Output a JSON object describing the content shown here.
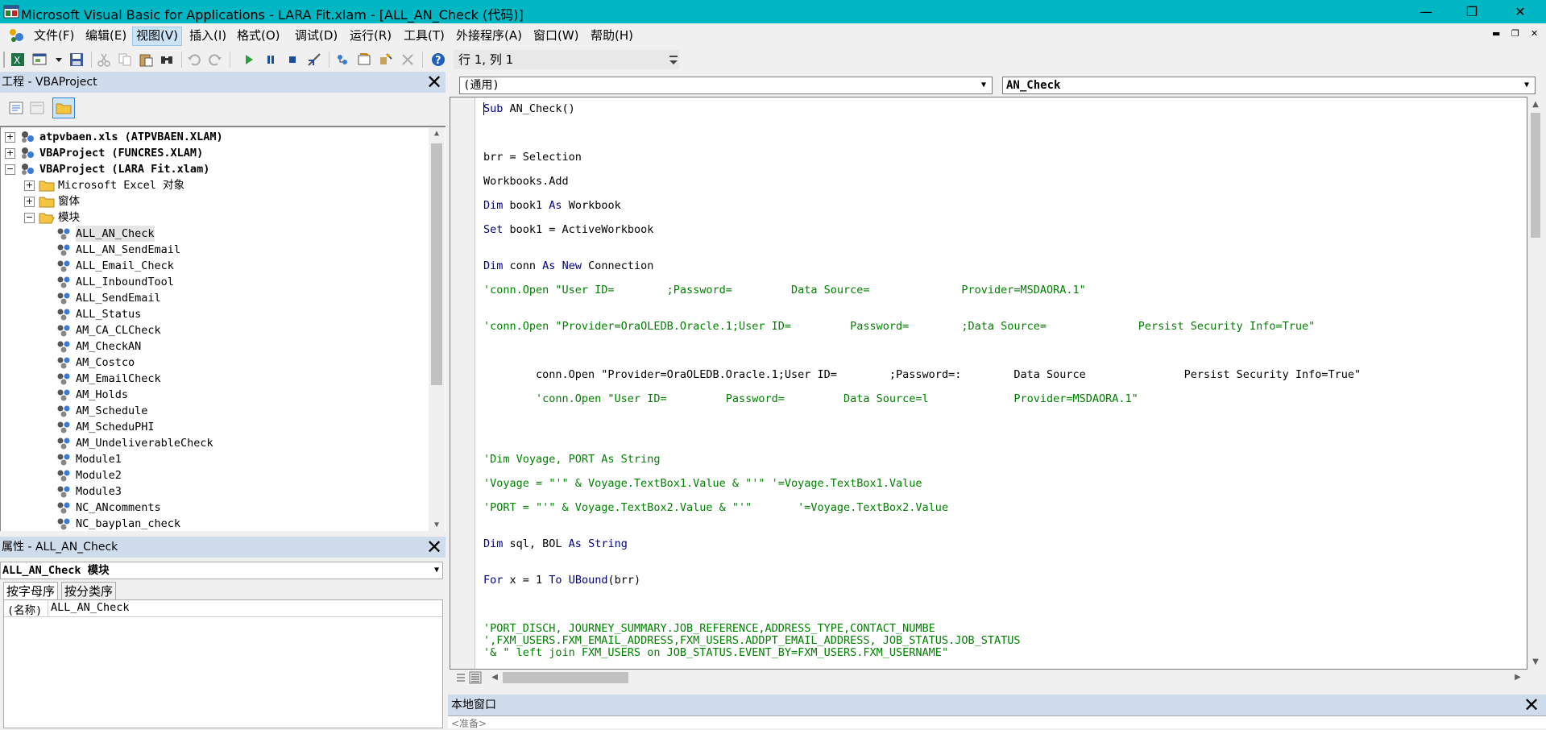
{
  "window": {
    "title": "Microsoft Visual Basic for Applications - LARA Fit.xlam - [ALL_AN_Check (代码)]",
    "minimize": "—",
    "restore": "❐",
    "close": "✕"
  },
  "menu": {
    "items": [
      {
        "label": "文件(F)"
      },
      {
        "label": "编辑(E)"
      },
      {
        "label": "视图(V)"
      },
      {
        "label": "插入(I)"
      },
      {
        "label": "格式(O)"
      },
      {
        "label": "调试(D)"
      },
      {
        "label": "运行(R)"
      },
      {
        "label": "工具(T)"
      },
      {
        "label": "外接程序(A)"
      },
      {
        "label": "窗口(W)"
      },
      {
        "label": "帮助(H)"
      }
    ],
    "active_index": 2,
    "mdi_minimize": "▬",
    "mdi_restore": "❐",
    "mdi_close": "✕"
  },
  "toolbar": {
    "position_label": "行 1, 列 1"
  },
  "project": {
    "header": "工程 - VBAProject",
    "close": "✕",
    "tree": [
      {
        "label": "atpvbaen.xls (ATPVBAEN.XLAM)",
        "expander": "+",
        "icon": "vba-project-icon",
        "bold": true
      },
      {
        "label": "VBAProject (FUNCRES.XLAM)",
        "expander": "+",
        "icon": "vba-project-icon",
        "bold": true
      },
      {
        "label": "VBAProject (LARA Fit.xlam)",
        "expander": "−",
        "icon": "vba-project-icon",
        "bold": true
      },
      {
        "label": "Microsoft Excel 对象",
        "expander": "+",
        "icon": "folder-icon"
      },
      {
        "label": "窗体",
        "expander": "+",
        "icon": "folder-icon"
      },
      {
        "label": "模块",
        "expander": "−",
        "icon": "folder-open-icon"
      },
      {
        "label": "ALL_AN_Check",
        "icon": "module-icon",
        "selected": true
      },
      {
        "label": "ALL_AN_SendEmail",
        "icon": "module-icon"
      },
      {
        "label": "ALL_Email_Check",
        "icon": "module-icon"
      },
      {
        "label": "ALL_InboundTool",
        "icon": "module-icon"
      },
      {
        "label": "ALL_SendEmail",
        "icon": "module-icon"
      },
      {
        "label": "ALL_Status",
        "icon": "module-icon"
      },
      {
        "label": "AM_CA_CLCheck",
        "icon": "module-icon"
      },
      {
        "label": "AM_CheckAN",
        "icon": "module-icon"
      },
      {
        "label": "AM_Costco",
        "icon": "module-icon"
      },
      {
        "label": "AM_EmailCheck",
        "icon": "module-icon"
      },
      {
        "label": "AM_Holds",
        "icon": "module-icon"
      },
      {
        "label": "AM_Schedule",
        "icon": "module-icon"
      },
      {
        "label": "AM_ScheduPHI",
        "icon": "module-icon"
      },
      {
        "label": "AM_UndeliverableCheck",
        "icon": "module-icon"
      },
      {
        "label": "Module1",
        "icon": "module-icon"
      },
      {
        "label": "Module2",
        "icon": "module-icon"
      },
      {
        "label": "Module3",
        "icon": "module-icon"
      },
      {
        "label": "NC_ANcomments",
        "icon": "module-icon"
      },
      {
        "label": "NC_bayplan_check",
        "icon": "module-icon"
      }
    ]
  },
  "properties": {
    "header": "属性 - ALL_AN_Check",
    "close": "✕",
    "object_combo": "ALL_AN_Check 模块",
    "tabs": [
      "按字母序",
      "按分类序"
    ],
    "active_tab": 0,
    "rows": [
      {
        "name": "(名称)",
        "value": "ALL_AN_Check"
      }
    ]
  },
  "code": {
    "object_combo": "(通用)",
    "procedure_combo": "AN_Check",
    "lines": [
      [
        {
          "t": "Sub",
          "c": "kw"
        },
        {
          "t": " AN_Check()",
          "c": ""
        }
      ],
      [
        {
          "t": "brr = Selection",
          "c": ""
        }
      ],
      [
        {
          "t": "Workbooks.Add",
          "c": ""
        }
      ],
      [
        {
          "t": "Dim",
          "c": "kw"
        },
        {
          "t": " book1 ",
          "c": ""
        },
        {
          "t": "As",
          "c": "kw"
        },
        {
          "t": " Workbook",
          "c": ""
        }
      ],
      [
        {
          "t": "Set",
          "c": "kw"
        },
        {
          "t": " book1 = ActiveWorkbook",
          "c": ""
        }
      ],
      [
        {
          "t": "Dim",
          "c": "kw"
        },
        {
          "t": " conn ",
          "c": ""
        },
        {
          "t": "As",
          "c": "kw"
        },
        {
          "t": " ",
          "c": ""
        },
        {
          "t": "New",
          "c": "kw"
        },
        {
          "t": " Connection",
          "c": ""
        }
      ],
      [
        {
          "t": "'conn.Open \"User ID=        ;Password=         Data Source=              Provider=MSDAORA.1\"",
          "c": "cm"
        }
      ],
      [
        {
          "t": "'conn.Open \"Provider=OraOLEDB.Oracle.1;User ID=         Password=        ;Data Source=              Persist Security Info=True\"",
          "c": "cm"
        }
      ],
      [
        {
          "t": "        conn.Open \"Provider=OraOLEDB.Oracle.1;User ID=        ;Password=:        Data Source               Persist Security Info=True\"",
          "c": ""
        }
      ],
      [
        {
          "t": "        'conn.Open \"User ID=         Password=         Data Source=l             Provider=MSDAORA.1\"",
          "c": "cm"
        }
      ],
      [
        {
          "t": "'Dim Voyage, PORT As String",
          "c": "cm"
        }
      ],
      [
        {
          "t": "'Voyage = \"'\" & Voyage.TextBox1.Value & \"'\" '=Voyage.TextBox1.Value",
          "c": "cm"
        }
      ],
      [
        {
          "t": "'PORT = \"'\" & Voyage.TextBox2.Value & \"'\"       '=Voyage.TextBox2.Value",
          "c": "cm"
        }
      ],
      [
        {
          "t": "Dim",
          "c": "kw"
        },
        {
          "t": " sql, BOL ",
          "c": ""
        },
        {
          "t": "As",
          "c": "kw"
        },
        {
          "t": " ",
          "c": ""
        },
        {
          "t": "String",
          "c": "kw"
        }
      ],
      [
        {
          "t": "For",
          "c": "kw"
        },
        {
          "t": " x = 1 ",
          "c": ""
        },
        {
          "t": "To",
          "c": "kw"
        },
        {
          "t": " ",
          "c": ""
        },
        {
          "t": "UBound",
          "c": "kw"
        },
        {
          "t": "(brr)",
          "c": ""
        }
      ],
      [
        {
          "t": "'PORT_DISCH, JOURNEY_SUMMARY.JOB_REFERENCE,ADDRESS_TYPE,CONTACT_NUMBE",
          "c": "cm"
        }
      ],
      [
        {
          "t": "',FXM_USERS.FXM_EMAIL_ADDRESS,FXM_USERS.ADDPT_EMAIL_ADDRESS, JOB_STATUS.JOB_STATUS",
          "c": "cm"
        }
      ],
      [
        {
          "t": "'& \" left join FXM_USERS on JOB_STATUS.EVENT_BY=FXM_USERS.FXM_USERNAME\"",
          "c": "cm"
        }
      ]
    ]
  },
  "locals": {
    "header": "本地窗口",
    "close": "✕",
    "status": "<准备>"
  }
}
